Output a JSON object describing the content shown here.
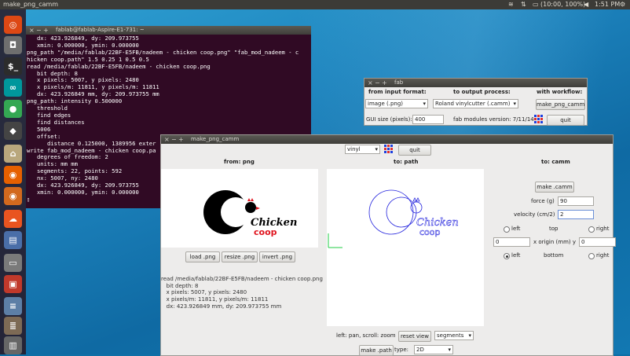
{
  "top_panel": {
    "title": "make_png_camm",
    "battery": "(10:00, 100%)",
    "clock": "1:51 PM"
  },
  "launcher": {
    "items": [
      {
        "name": "ubuntu-dash",
        "color": "#dd4814",
        "glyph": "◎"
      },
      {
        "name": "camera",
        "color": "#6e6e6e",
        "glyph": "◘"
      },
      {
        "name": "terminal",
        "color": "#2c2c2c",
        "glyph": "$_"
      },
      {
        "name": "arduino",
        "color": "#00979c",
        "glyph": "∞"
      },
      {
        "name": "chrome",
        "color": "#34a853",
        "glyph": "●"
      },
      {
        "name": "inkscape",
        "color": "#444444",
        "glyph": "◆"
      },
      {
        "name": "home-folder",
        "color": "#b9a77d",
        "glyph": "⌂"
      },
      {
        "name": "firefox",
        "color": "#e66000",
        "glyph": "◉"
      },
      {
        "name": "firefox-alt",
        "color": "#d2691e",
        "glyph": "◉"
      },
      {
        "name": "ubuntu-one",
        "color": "#e95420",
        "glyph": "☁"
      },
      {
        "name": "writer",
        "color": "#4a6ea8",
        "glyph": "▤"
      },
      {
        "name": "scanner",
        "color": "#7a7a7a",
        "glyph": "▭"
      },
      {
        "name": "software-center",
        "color": "#c0392b",
        "glyph": "▣"
      },
      {
        "name": "file-cabinet",
        "color": "#5d7fa6",
        "glyph": "≡"
      },
      {
        "name": "stack-app",
        "color": "#7d6a55",
        "glyph": "≣"
      },
      {
        "name": "trash",
        "color": "#666666",
        "glyph": "▥"
      }
    ]
  },
  "terminal": {
    "title": "fablab@fablab-Aspire-E1-731: ~",
    "lines": [
      "   dx: 423.926849, dy: 209.973755",
      "   xmin: 0.000000, ymin: 0.000000",
      "png_path \"/media/fablab/22BF-E5FB/nadeem - chicken coop.png\" \"fab_mod_nadeem - c",
      "hicken coop.path\" 1.5 0.25 1 0.5 0.5",
      "read /media/fablab/22BF-E5FB/nadeem - chicken coop.png",
      "   bit depth: 8",
      "   x pixels: 5007, y pixels: 2480",
      "   x pixels/m: 11811, y pixels/m: 11811",
      "   dx: 423.926849 mm, dy: 209.973755 mm",
      "png_path: intensity 0.500000",
      "   threshold",
      "   find edges",
      "   find distances",
      "   5006",
      "   offset:",
      "      distance 0.125000, 1389956 exter",
      "write fab_mod_nadeem - chicken coop.pa",
      "   degrees of freedom: 2",
      "   units: mm mm",
      "   segments: 22, points: 592",
      "   nx: 5007, ny: 2480",
      "   dx: 423.926849, dy: 209.973755",
      "   xmin: 0.000000, ymin: 0.000000",
      "▯"
    ]
  },
  "fab": {
    "title": "fab",
    "from_label": "from input format:",
    "to_label": "to output process:",
    "workflow_label": "with workflow:",
    "input_format": "image (.png)",
    "output_process": "Roland vinylcutter (.camm)",
    "workflow_button": "make_png_camm",
    "gui_size_label": "GUI size (pixels):",
    "gui_size_value": "400",
    "version": "fab modules version: 7/11/14",
    "quit": "quit"
  },
  "make": {
    "title": "make_png_camm",
    "material": "vinyl",
    "quit": "quit",
    "from_header": "from: png",
    "to_path_header": "to: path",
    "to_camm_header": "to: camm",
    "load_button": "load .png",
    "resize_button": "resize .png",
    "invert_button": "invert .png",
    "info_lines": [
      "read /media/fablab/22BF-E5FB/nadeem - chicken coop.png",
      "   bit depth: 8",
      "   x pixels: 5007, y pixels: 2480",
      "   x pixels/m: 11811, y pixels/m: 11811",
      "   dx: 423.926849 mm, dy: 209.973755 mm"
    ],
    "logo_word_1": "hicken",
    "logo_word_1_initial": "C",
    "logo_word_2": "coop",
    "pan_label": "left: pan, scroll: zoom",
    "reset_view": "reset view",
    "view_mode": "segments",
    "make_path": "make .path",
    "type_label": "type:",
    "type_value": "2D",
    "make_camm": "make .camm",
    "force_label": "force (g)",
    "force_value": "90",
    "velocity_label": "velocity (cm/2)",
    "velocity_value": "2",
    "left": "left",
    "top": "top",
    "right": "right",
    "origin_label": "x origin (mm) y",
    "x_origin": "0",
    "y_origin": "0",
    "bottom": "bottom",
    "left2": "left",
    "right2": "right"
  },
  "colors": {
    "terminal_bg": "#300a24",
    "panel_bg": "#3c3b37",
    "window_bg": "#edeceb",
    "logo_red": "#e0141e",
    "path_blue": "#2222dd"
  }
}
